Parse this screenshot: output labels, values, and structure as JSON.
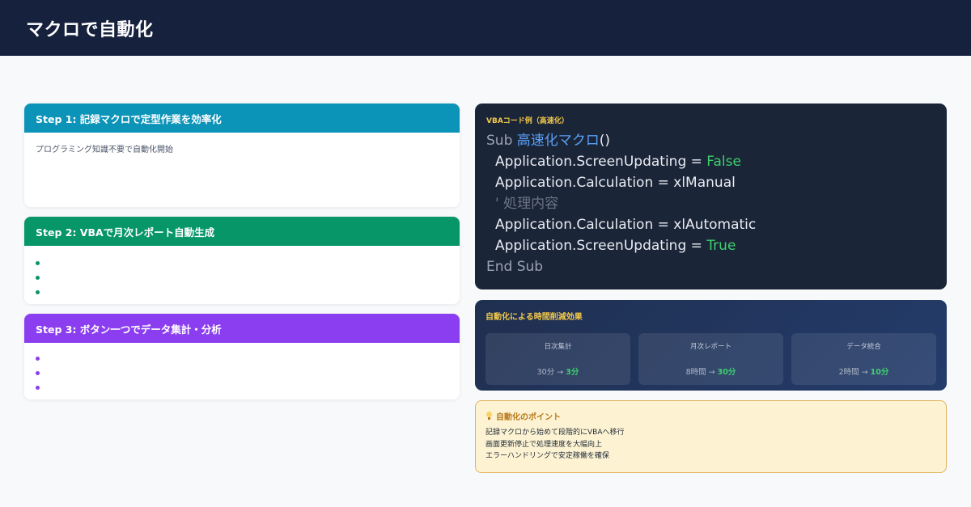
{
  "header": {
    "title": "マクロで自動化"
  },
  "steps": [
    {
      "title": "Step 1: 記録マクロで定型作業を効率化",
      "desc": "プログラミング知識不要で自動化開始",
      "color": "#0b93b8"
    },
    {
      "title": "Step 2: VBAで月次レポート自動生成",
      "color": "#069668"
    },
    {
      "title": "Step 3: ボタン一つでデータ集計・分析",
      "color": "#8b3ef0"
    }
  ],
  "code_card": {
    "title": "VBAコード例（高速化）",
    "lines": {
      "sub_kw": "Sub",
      "sub_name": "高速化マクロ",
      "sub_parens": "()",
      "l1_text": "Application.ScreenUpdating = ",
      "l1_val": "False",
      "l2_text": "Application.Calculation = xlManual",
      "l3_comment": "' 処理内容",
      "l4_text": "Application.Calculation = xlAutomatic",
      "l5_text": "Application.ScreenUpdating = ",
      "l5_val": "True",
      "end": "End Sub"
    }
  },
  "effect": {
    "title": "自動化による時間削減効果",
    "metrics": [
      {
        "label": "日次集計",
        "before": "30分",
        "arrow": "→",
        "after": "3分"
      },
      {
        "label": "月次レポート",
        "before": "8時間",
        "arrow": "→",
        "after": "30分"
      },
      {
        "label": "データ統合",
        "before": "2時間",
        "arrow": "→",
        "after": "10分"
      }
    ]
  },
  "points": {
    "title": "自動化のポイント",
    "items": [
      "記録マクロから始めて段階的にVBAへ移行",
      "画面更新停止で処理速度を大幅向上",
      "エラーハンドリングで安定稼働を確保"
    ]
  }
}
